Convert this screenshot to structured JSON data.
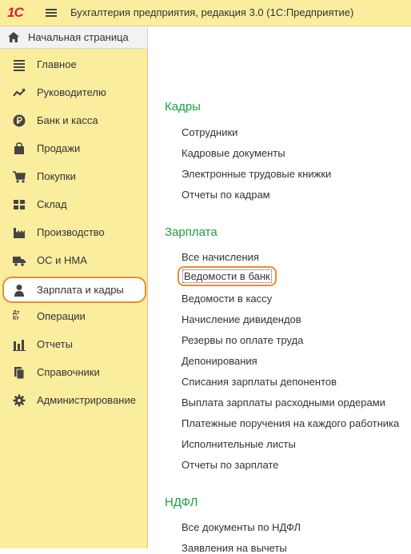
{
  "titlebar": {
    "logo_text": "1С",
    "title": "Бухгалтерия предприятия, редакция 3.0  (1С:Предприятие)"
  },
  "home": {
    "label": "Начальная страница",
    "icon": "home-icon"
  },
  "sidebar": {
    "items": [
      {
        "label": "Главное",
        "icon": "list-icon"
      },
      {
        "label": "Руководителю",
        "icon": "trend-icon"
      },
      {
        "label": "Банк и касса",
        "icon": "ruble-icon"
      },
      {
        "label": "Продажи",
        "icon": "bag-icon"
      },
      {
        "label": "Покупки",
        "icon": "cart-icon"
      },
      {
        "label": "Склад",
        "icon": "warehouse-icon"
      },
      {
        "label": "Производство",
        "icon": "factory-icon"
      },
      {
        "label": "ОС и НМА",
        "icon": "truck-icon"
      },
      {
        "label": "Зарплата и кадры",
        "icon": "person-icon",
        "active": true
      },
      {
        "label": "Операции",
        "icon": "dt-kt-icon",
        "icon_text": "Дт Кт"
      },
      {
        "label": "Отчеты",
        "icon": "bar-chart-icon"
      },
      {
        "label": "Справочники",
        "icon": "books-icon"
      },
      {
        "label": "Администрирование",
        "icon": "gear-icon"
      }
    ]
  },
  "content": {
    "sections": [
      {
        "title": "Кадры",
        "links": [
          "Сотрудники",
          "Кадровые документы",
          "Электронные трудовые книжки",
          "Отчеты по кадрам"
        ]
      },
      {
        "title": "Зарплата",
        "links": [
          "Все начисления",
          "Ведомости в банк",
          "Ведомости в кассу",
          "Начисление дивидендов",
          "Резервы по оплате труда",
          "Депонирования",
          "Списания зарплаты депонентов",
          "Выплата зарплаты расходными ордерами",
          "Платежные поручения на каждого работника",
          "Исполнительные листы",
          "Отчеты по зарплате"
        ]
      },
      {
        "title": "НДФЛ",
        "links": [
          "Все документы по НДФЛ",
          "Заявления на вычеты"
        ]
      }
    ],
    "highlighted_link": "Ведомости в банк"
  },
  "colors": {
    "sidebar_bg": "#fbed9e",
    "section_title": "#1f9e45",
    "highlight": "#ee8a2e",
    "logo": "#d6242a"
  }
}
